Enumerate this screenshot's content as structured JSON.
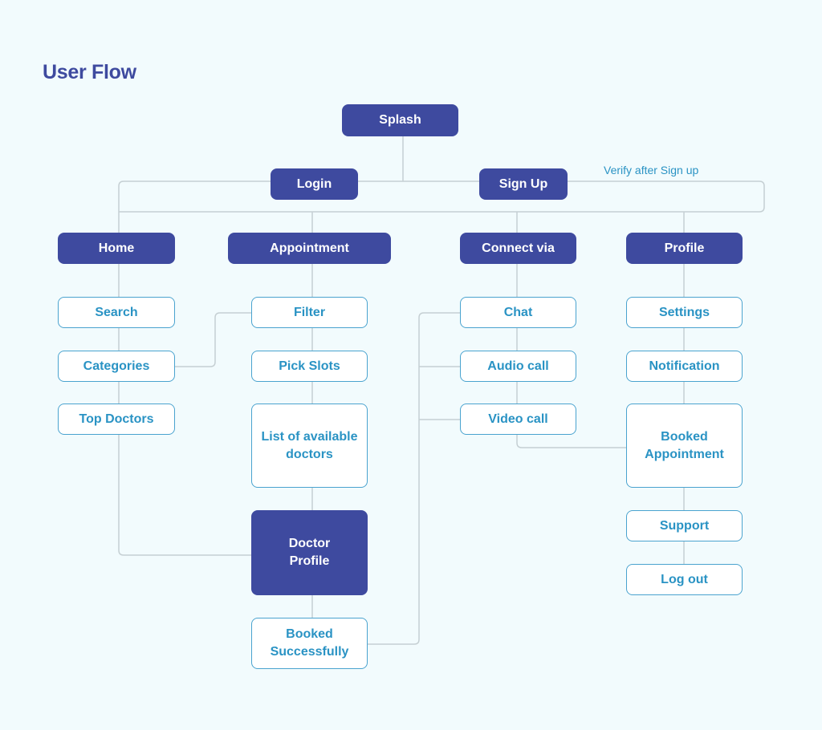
{
  "title": "User Flow",
  "note": "Verify after Sign up",
  "colors": {
    "background": "#f2fbfd",
    "primary_fill": "#3e4a9f",
    "secondary_text": "#2a93c4",
    "secondary_border": "#4aa3cf",
    "connector": "#c5cfd3"
  },
  "nodes": {
    "splash": "Splash",
    "login": "Login",
    "signup": "Sign Up",
    "home": "Home",
    "appointment": "Appointment",
    "connect_via": "Connect via",
    "profile": "Profile",
    "search": "Search",
    "categories": "Categories",
    "top_doctors": "Top Doctors",
    "filter": "Filter",
    "pick_slots": "Pick Slots",
    "list_doctors": "List of available\ndoctors",
    "doctor_profile": "Doctor\nProfile",
    "booked_successfully": "Booked\nSuccessfully",
    "chat": "Chat",
    "audio_call": "Audio call",
    "video_call": "Video call",
    "settings": "Settings",
    "notification": "Notification",
    "booked_appointment": "Booked\nAppointment",
    "support": "Support",
    "log_out": "Log out"
  },
  "edges": [
    [
      "splash",
      "login"
    ],
    [
      "splash",
      "signup"
    ],
    [
      "login",
      "home"
    ],
    [
      "login",
      "appointment"
    ],
    [
      "login",
      "connect_via"
    ],
    [
      "login",
      "profile"
    ],
    [
      "signup",
      "login"
    ],
    [
      "home",
      "search"
    ],
    [
      "search",
      "categories"
    ],
    [
      "categories",
      "top_doctors"
    ],
    [
      "top_doctors",
      "doctor_profile"
    ],
    [
      "categories",
      "filter"
    ],
    [
      "appointment",
      "filter"
    ],
    [
      "filter",
      "pick_slots"
    ],
    [
      "pick_slots",
      "list_doctors"
    ],
    [
      "list_doctors",
      "doctor_profile"
    ],
    [
      "doctor_profile",
      "booked_successfully"
    ],
    [
      "booked_successfully",
      "chat"
    ],
    [
      "booked_successfully",
      "audio_call"
    ],
    [
      "booked_successfully",
      "video_call"
    ],
    [
      "connect_via",
      "chat"
    ],
    [
      "chat",
      "audio_call"
    ],
    [
      "audio_call",
      "video_call"
    ],
    [
      "video_call",
      "booked_appointment"
    ],
    [
      "profile",
      "settings"
    ],
    [
      "settings",
      "notification"
    ],
    [
      "notification",
      "booked_appointment"
    ],
    [
      "booked_appointment",
      "support"
    ],
    [
      "support",
      "log_out"
    ]
  ]
}
